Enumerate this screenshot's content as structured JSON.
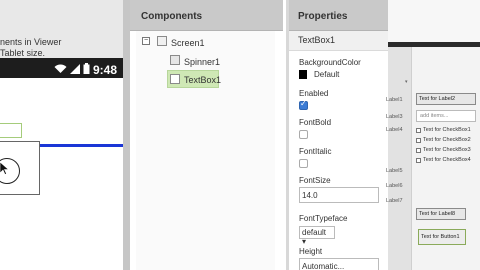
{
  "viewer": {
    "line1": "nents in Viewer",
    "line2": "Tablet size.",
    "status_time": "9:48"
  },
  "components": {
    "title": "Components",
    "tree": [
      {
        "label": "Screen1",
        "toggle": "−"
      },
      {
        "label": "Spinner1"
      },
      {
        "label": "TextBox1"
      }
    ]
  },
  "properties": {
    "title": "Properties",
    "selected_component": "TextBox1",
    "background_color_label": "BackgroundColor",
    "background_color_value": "Default",
    "enabled_label": "Enabled",
    "enabled_checked": true,
    "fontbold_label": "FontBold",
    "fontbold_checked": false,
    "fontitalic_label": "FontItalic",
    "fontitalic_checked": false,
    "fontsize_label": "FontSize",
    "fontsize_value": "14.0",
    "fonttypeface_label": "FontTypeface",
    "fonttypeface_value": "default ▾",
    "height_label": "Height",
    "height_value": "Automatic..."
  },
  "right_window": {
    "label_top_left": "Text for Label2",
    "label1": "Label1",
    "label3": "Label3",
    "label4": "Label4",
    "label5": "Label5",
    "label6": "Label6",
    "label7": "Label7",
    "add_items_placeholder": "add items...",
    "checkboxes": [
      "Text for CheckBox1",
      "Text for CheckBox2",
      "Text for CheckBox3",
      "Text for CheckBox4"
    ],
    "label8": "Text for Label8",
    "button1": "Text for Button1"
  },
  "colors": {
    "accent_blue": "#1a36d6",
    "selection_green": "#cfe8b5",
    "panel_header": "#c9c9c9"
  }
}
